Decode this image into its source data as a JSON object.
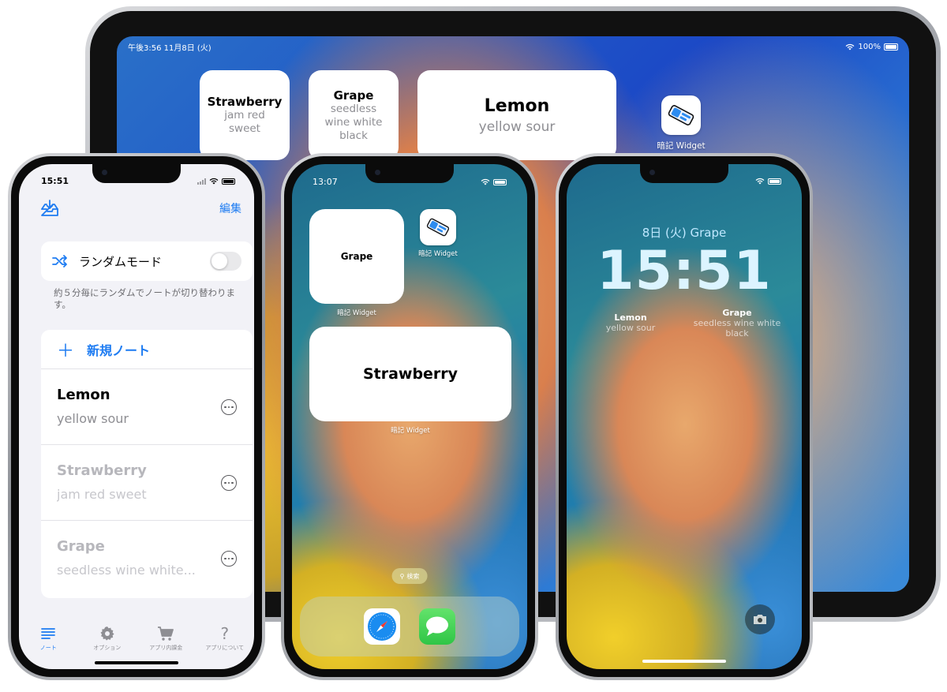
{
  "ipad": {
    "status_left": "午後3:56 11月8日 (火)",
    "status_battery": "100%",
    "widgets": [
      {
        "title": "Strawberry",
        "subtitle": "jam red sweet"
      },
      {
        "title": "Grape",
        "subtitle": "seedless wine white black"
      },
      {
        "title": "Lemon",
        "subtitle": "yellow sour"
      }
    ],
    "app_label": "暗記 Widget"
  },
  "app_phone": {
    "time": "15:51",
    "edit_label": "編集",
    "random_mode_label": "ランダムモード",
    "random_mode_on": false,
    "random_mode_note": "約５分毎にランダムでノートが切り替わります。",
    "new_note_label": "新規ノート",
    "notes": [
      {
        "title": "Lemon",
        "subtitle": "yellow sour",
        "active": true
      },
      {
        "title": "Strawberry",
        "subtitle": "jam red sweet",
        "active": false
      },
      {
        "title": "Grape",
        "subtitle": "seedless wine white...",
        "active": false
      }
    ],
    "tabs": [
      {
        "label": "ノート",
        "icon": "list-icon",
        "active": true
      },
      {
        "label": "オプション",
        "icon": "gear-icon",
        "active": false
      },
      {
        "label": "アプリ内課金",
        "icon": "cart-icon",
        "active": false
      },
      {
        "label": "アプリについて",
        "icon": "question-icon",
        "active": false
      }
    ],
    "accent_color": "#1e7cf2"
  },
  "home_phone": {
    "time": "13:07",
    "small_widget_title": "Grape",
    "small_widget_label": "暗記 Widget",
    "app_label": "暗記 Widget",
    "medium_widget_title": "Strawberry",
    "medium_widget_label": "暗記 Widget",
    "search_label": "検索",
    "dock_apps": [
      "safari-icon",
      "messages-icon"
    ]
  },
  "lock_phone": {
    "date_line": "8日 (火)  Grape",
    "time": "15:51",
    "widget_left": {
      "title": "Lemon",
      "subtitle": "yellow sour"
    },
    "widget_right": {
      "title": "Grape",
      "subtitle": "seedless wine white black"
    }
  }
}
